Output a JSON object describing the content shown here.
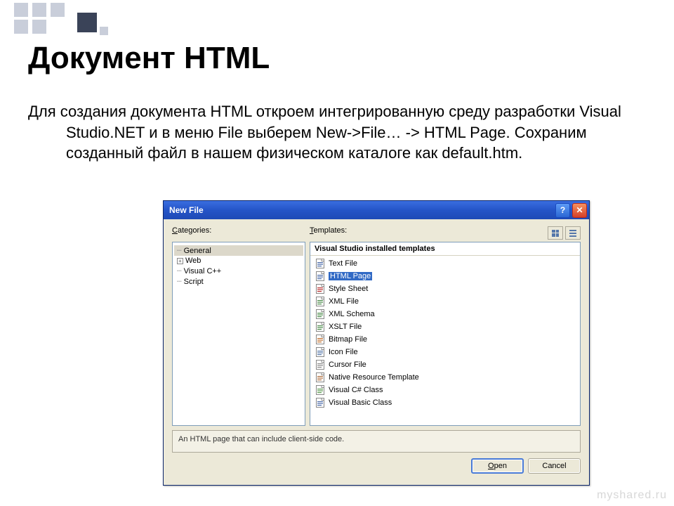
{
  "slide": {
    "title": "Документ HTML",
    "body": "Для создания документа HTML откроем интегрированную среду разработки Visual Studio.NET и в меню File выберем New->File… -> HTML Page. Сохраним созданный файл в нашем физическом каталоге как default.htm."
  },
  "dialog": {
    "title": "New File",
    "categories_label": "Categories:",
    "templates_label": "Templates:",
    "categories": [
      {
        "label": "General",
        "expandable": false,
        "selected": true,
        "indent": 0,
        "prefix": ""
      },
      {
        "label": "Web",
        "expandable": true,
        "selected": false,
        "indent": 0,
        "prefix": "plus"
      },
      {
        "label": "Visual C++",
        "expandable": false,
        "selected": false,
        "indent": 0,
        "prefix": "dots"
      },
      {
        "label": "Script",
        "expandable": false,
        "selected": false,
        "indent": 0,
        "prefix": "dots"
      }
    ],
    "templates_header": "Visual Studio installed templates",
    "templates": [
      {
        "label": "Text File",
        "icon": "text-file-icon",
        "selected": false
      },
      {
        "label": "HTML Page",
        "icon": "html-page-icon",
        "selected": true
      },
      {
        "label": "Style Sheet",
        "icon": "style-sheet-icon",
        "selected": false
      },
      {
        "label": "XML File",
        "icon": "xml-file-icon",
        "selected": false
      },
      {
        "label": "XML Schema",
        "icon": "xml-schema-icon",
        "selected": false
      },
      {
        "label": "XSLT File",
        "icon": "xslt-file-icon",
        "selected": false
      },
      {
        "label": "Bitmap File",
        "icon": "bitmap-file-icon",
        "selected": false
      },
      {
        "label": "Icon File",
        "icon": "icon-file-icon",
        "selected": false
      },
      {
        "label": "Cursor File",
        "icon": "cursor-file-icon",
        "selected": false
      },
      {
        "label": "Native Resource Template",
        "icon": "resource-template-icon",
        "selected": false
      },
      {
        "label": "Visual C# Class",
        "icon": "csharp-class-icon",
        "selected": false
      },
      {
        "label": "Visual Basic Class",
        "icon": "vb-class-icon",
        "selected": false
      }
    ],
    "description": "An HTML page that can include client-side code.",
    "buttons": {
      "open": "Open",
      "cancel": "Cancel"
    }
  },
  "watermark": "myshared.ru",
  "icon_colors": {
    "text-file-icon": "#4a6aa8",
    "html-page-icon": "#4a6aa8",
    "style-sheet-icon": "#b83030",
    "xml-file-icon": "#4a8a4a",
    "xml-schema-icon": "#4a8a4a",
    "xslt-file-icon": "#4a8a4a",
    "bitmap-file-icon": "#c07030",
    "icon-file-icon": "#5577aa",
    "cursor-file-icon": "#888",
    "resource-template-icon": "#b07040",
    "csharp-class-icon": "#5a9a50",
    "vb-class-icon": "#4a6aa8"
  }
}
